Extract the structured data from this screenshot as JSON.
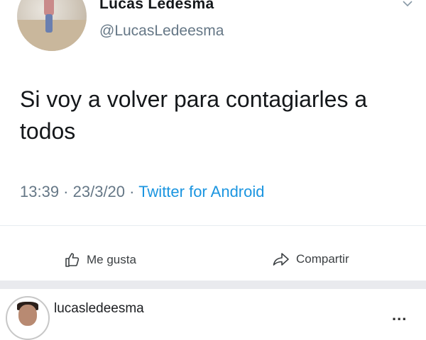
{
  "tweet": {
    "display_name": "Lucas Ledesma",
    "handle": "@LucasLedeesma",
    "text": "Si voy a volver para contagiarles a todos",
    "time": "13:39",
    "separator_1": " · ",
    "date": "23/3/20",
    "separator_2": " · ",
    "source": "Twitter for Android"
  },
  "actions": {
    "like_label": "Me gusta",
    "share_label": "Compartir"
  },
  "post": {
    "username": "lucasledeesma",
    "more_label": "..."
  },
  "icons": {
    "caret": "chevron-down-icon",
    "like": "thumbs-up-icon",
    "share": "share-arrow-icon",
    "more": "more-dots-icon"
  },
  "colors": {
    "link": "#1b95e0",
    "secondary_text": "#657786",
    "band": "#e9eaee"
  }
}
